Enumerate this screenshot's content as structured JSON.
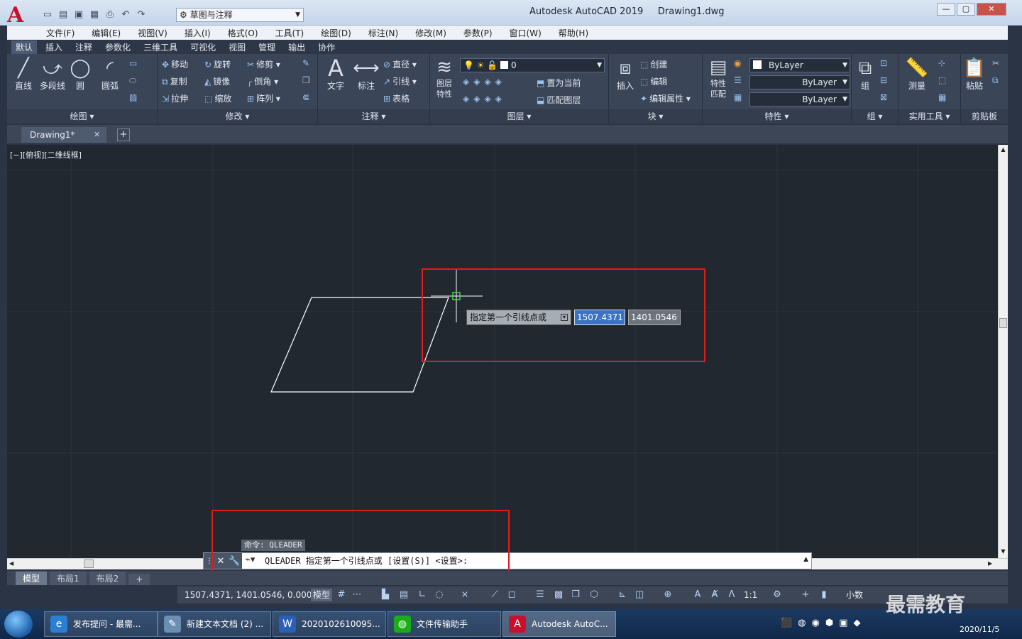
{
  "title_bar": {
    "app_title": "Autodesk AutoCAD 2019",
    "file_name": "Drawing1.dwg",
    "workspace": "草图与注释"
  },
  "menu": [
    "文件(F)",
    "编辑(E)",
    "视图(V)",
    "插入(I)",
    "格式(O)",
    "工具(T)",
    "绘图(D)",
    "标注(N)",
    "修改(M)",
    "参数(P)",
    "窗口(W)",
    "帮助(H)"
  ],
  "ribbon_tabs": [
    "默认",
    "插入",
    "注释",
    "参数化",
    "三维工具",
    "可视化",
    "视图",
    "管理",
    "输出",
    "协作"
  ],
  "ribbon": {
    "draw": {
      "label": "绘图",
      "line": "直线",
      "polyline": "多段线",
      "circle": "圆",
      "arc": "圆弧"
    },
    "modify": {
      "label": "修改",
      "move": "移动",
      "rotate": "旋转",
      "trim": "修剪",
      "copy": "复制",
      "mirror": "镜像",
      "fillet": "倒角",
      "stretch": "拉伸",
      "scale": "缩放",
      "array": "阵列"
    },
    "annotation": {
      "label": "注释",
      "text": "文字",
      "dimension": "标注",
      "diameter": "直径",
      "leader": "引线",
      "table": "表格"
    },
    "layers": {
      "label": "图层",
      "layer_props": "图层\n特性",
      "current_layer": "0",
      "set_current": "置为当前",
      "match_layer": "匹配图层"
    },
    "block": {
      "label": "块",
      "insert": "插入",
      "create": "创建",
      "edit": "编辑",
      "edit_attr": "编辑属性"
    },
    "properties": {
      "label": "特性",
      "match": "特性\n匹配",
      "color": "ByLayer",
      "linetype": "ByLayer",
      "lineweight": "ByLayer"
    },
    "groups": {
      "label": "组",
      "group": "组"
    },
    "utilities": {
      "label": "实用工具",
      "measure": "测量"
    },
    "clipboard": {
      "label": "剪贴板",
      "paste": "粘贴"
    }
  },
  "doc_tab": "Drawing1*",
  "viewport_label": "[−][俯视][二维线框]",
  "dynamic_input": {
    "prompt": "指定第一个引线点或",
    "x": "1507.4371",
    "y": "1401.0546"
  },
  "command": {
    "history": "命令: QLEADER",
    "current": "QLEADER 指定第一个引线点或 [设置(S)] <设置>:"
  },
  "layout_tabs": [
    "模型",
    "布局1",
    "布局2"
  ],
  "status": {
    "coords": "1507.4371, 1401.0546, 0.0000",
    "model": "模型",
    "scale": "1:1",
    "units": "小数"
  },
  "taskbar": [
    {
      "label": "发布提问 - 最需...",
      "icon": "ie-icon",
      "color": "#2a7fd4"
    },
    {
      "label": "新建文本文档 (2) ...",
      "icon": "notepad-icon",
      "color": "#6b8fb3"
    },
    {
      "label": "2020102610095...",
      "icon": "word-icon",
      "color": "#2b5fb8"
    },
    {
      "label": "文件传输助手",
      "icon": "wechat-icon",
      "color": "#1aad19"
    },
    {
      "label": "Autodesk AutoC...",
      "icon": "autocad-icon",
      "color": "#c8102e"
    }
  ],
  "clock": {
    "date": "2020/11/5"
  },
  "watermark": "最需教育"
}
